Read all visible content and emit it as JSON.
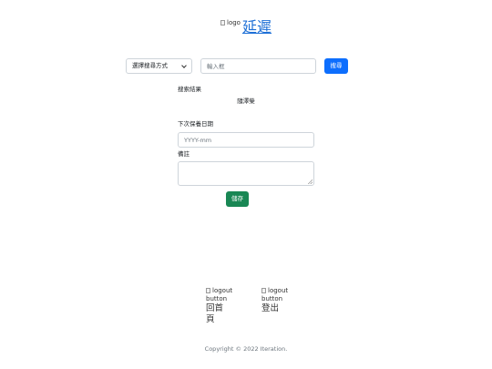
{
  "header": {
    "logo_alt": "logo",
    "brand": "延遲"
  },
  "search": {
    "method_selected": "選擇搜尋方式",
    "input_placeholder": "輸入框",
    "button_label": "搜尋"
  },
  "result": {
    "label": "搜索結果",
    "value": "隨澤榮"
  },
  "form": {
    "date_label": "下次保養日期",
    "date_placeholder": "YYYY-mm",
    "notes_label": "備註",
    "save_label": "儲存"
  },
  "nav": {
    "home_alt": "logout button",
    "home_label": "回首頁",
    "logout_alt": "logout button",
    "logout_label": "登出"
  },
  "footer": {
    "copyright": "Copyright © 2022 Iteration."
  },
  "colors": {
    "primary": "#0d6efd",
    "success": "#198754",
    "link": "#1d6fd6",
    "muted": "#6c757d"
  }
}
